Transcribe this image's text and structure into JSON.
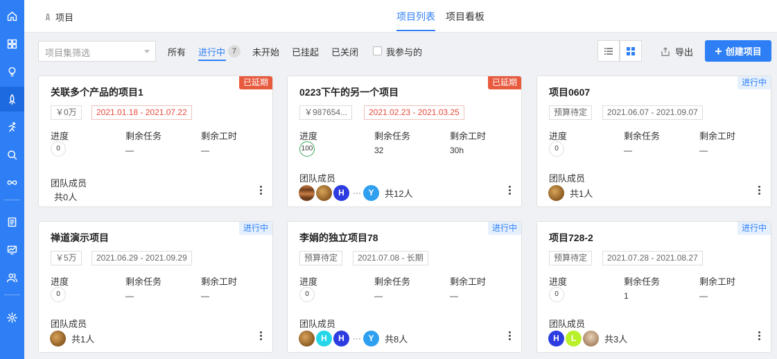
{
  "header": {
    "breadcrumb": "项目",
    "tabs": [
      "项目列表",
      "项目看板"
    ]
  },
  "toolbar": {
    "program_select_placeholder": "项目集筛选",
    "filters": [
      "所有",
      "进行中",
      "未开始",
      "已挂起",
      "已关闭"
    ],
    "running_count": "7",
    "mine_label": "我参与的",
    "export_label": "导出",
    "create_label": "创建项目"
  },
  "labels": {
    "progress": "进度",
    "remaining_tasks": "剩余任务",
    "remaining_hours": "剩余工时",
    "team_members": "团队成员"
  },
  "projects": [
    {
      "title": "关联多个产品的项目1",
      "status": "已延期",
      "budget": "￥0万",
      "dates": "2021.01.18 - 2021.07.22",
      "progress": "0",
      "tasks": "—",
      "hours": "—",
      "members_total": "共0人"
    },
    {
      "title": "0223下午的另一个项目",
      "status": "已延期",
      "budget": "￥987654...",
      "dates": "2021.02.23 - 2021.03.25",
      "progress": "100",
      "tasks": "32",
      "hours": "30h",
      "members_total": "共12人",
      "avatar_h": "H",
      "avatar_y": "Y"
    },
    {
      "title": "项目0607",
      "status": "进行中",
      "budget": "预算待定",
      "dates": "2021.06.07 - 2021.09.07",
      "progress": "0",
      "tasks": "—",
      "hours": "—",
      "members_total": "共1人"
    },
    {
      "title": "禅道演示项目",
      "status": "进行中",
      "budget": "￥5万",
      "dates": "2021.06.29 - 2021.09.29",
      "progress": "0",
      "tasks": "—",
      "hours": "—",
      "members_total": "共1人"
    },
    {
      "title": "李娟的独立项目78",
      "status": "进行中",
      "budget": "预算待定",
      "dates": "2021.07.08 - 长期",
      "progress": "0",
      "tasks": "—",
      "hours": "—",
      "members_total": "共8人",
      "avatar_h1": "H",
      "avatar_h2": "H",
      "avatar_y": "Y"
    },
    {
      "title": "项目728-2",
      "status": "进行中",
      "budget": "预算待定",
      "dates": "2021.07.28 - 2021.08.27",
      "progress": "0",
      "tasks": "1",
      "hours": "—",
      "members_total": "共3人",
      "avatar_h": "H",
      "avatar_l": "L"
    }
  ],
  "colors": {
    "accent": "#2e7ff5",
    "delayed": "#e85a3e",
    "avatar_h": "#2c3ce0",
    "avatar_y": "#2fa0f0",
    "avatar_h_cyan": "#24d6e8",
    "avatar_l": "#b8f02a"
  }
}
